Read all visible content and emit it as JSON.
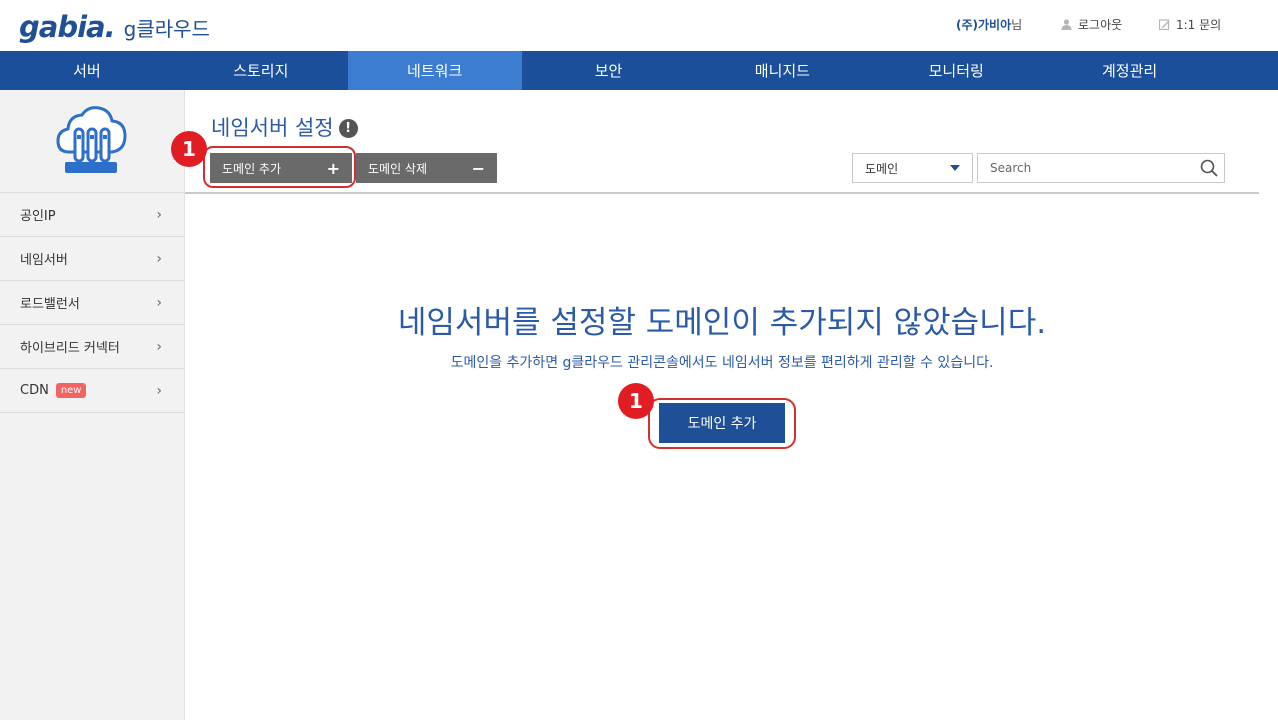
{
  "header": {
    "logo_mark": "gabia.",
    "logo_sub": "g클라우드",
    "company": "(주)가비아",
    "company_suffix": "님",
    "logout_label": "로그아웃",
    "inquiry_label": "1:1 문의"
  },
  "nav": {
    "items": [
      {
        "label": "서버"
      },
      {
        "label": "스토리지"
      },
      {
        "label": "네트워크"
      },
      {
        "label": "보안"
      },
      {
        "label": "매니지드"
      },
      {
        "label": "모니터링"
      },
      {
        "label": "계정관리"
      }
    ],
    "active_index": 2
  },
  "sidebar": {
    "items": [
      {
        "label": "공인IP"
      },
      {
        "label": "네임서버"
      },
      {
        "label": "로드밸런서"
      },
      {
        "label": "하이브리드 커넥터"
      },
      {
        "label": "CDN",
        "badge": "new"
      }
    ]
  },
  "page": {
    "title": "네임서버 설정",
    "help_symbol": "!",
    "add_domain_label": "도메인 추가",
    "add_symbol": "+",
    "delete_domain_label": "도메인 삭제",
    "delete_symbol": "−",
    "filter_selected": "도메인",
    "search_placeholder": "Search"
  },
  "empty_state": {
    "title": "네임서버를 설정할 도메인이 추가되지 않았습니다.",
    "subtitle": "도메인을 추가하면 g클라우드 관리콘솔에서도 네임서버 정보를 편리하게 관리할 수 있습니다.",
    "button_label": "도메인 추가"
  },
  "callouts": {
    "top_number": "1",
    "main_number": "1"
  },
  "colors": {
    "brand": "#1b4f9a",
    "nav_active": "#3c7dd2",
    "callout": "#e11d24",
    "badge": "#f06563"
  }
}
